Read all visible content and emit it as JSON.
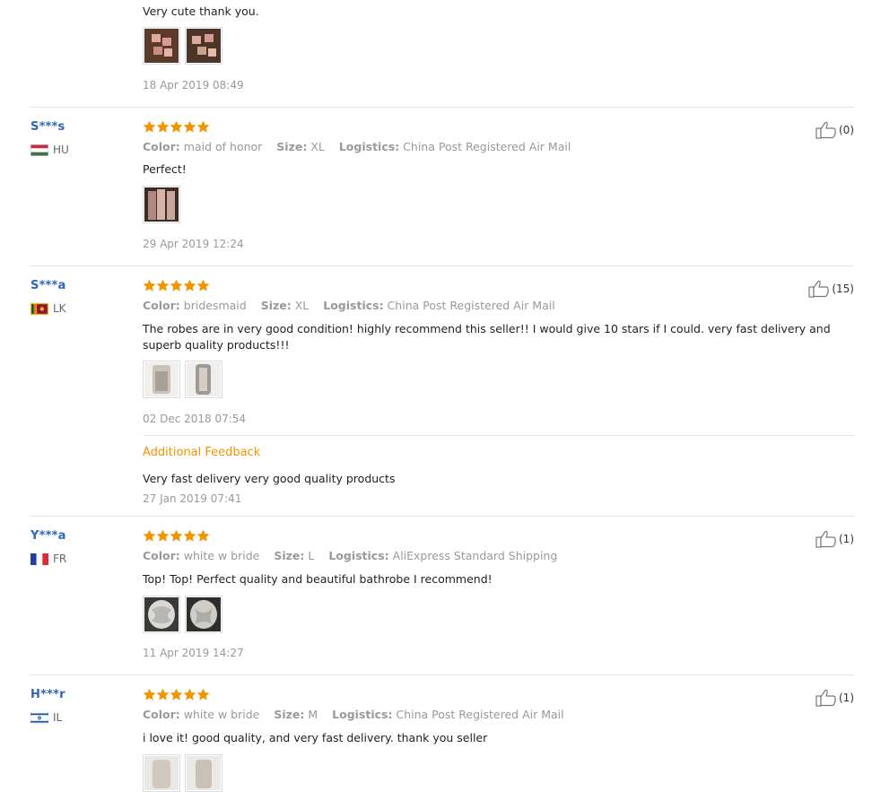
{
  "reviews": [
    {
      "text": "Very cute thank you.",
      "date": "18 Apr 2019 08:49"
    },
    {
      "user": "S***s",
      "country": "HU",
      "color_label": "Color:",
      "color": "maid of honor",
      "size_label": "Size:",
      "size": "XL",
      "logistics_label": "Logistics:",
      "logistics": "China Post Registered Air Mail",
      "text": "Perfect!",
      "date": "29 Apr 2019 12:24",
      "helpful": "(0)",
      "rating": 5
    },
    {
      "user": "S***a",
      "country": "LK",
      "color_label": "Color:",
      "color": "bridesmaid",
      "size_label": "Size:",
      "size": "XL",
      "logistics_label": "Logistics:",
      "logistics": "China Post Registered Air Mail",
      "text": "The robes are in very good condition! highly recommend this seller!! I would give 10 stars if I could. very fast delivery and superb quality products!!!",
      "date": "02 Dec 2018 07:54",
      "helpful": "(15)",
      "rating": 5,
      "additional_title": "Additional Feedback",
      "additional_text": "Very fast delivery very good quality products",
      "additional_date": "27 Jan 2019 07:41"
    },
    {
      "user": "Y***a",
      "country": "FR",
      "color_label": "Color:",
      "color": "white w bride",
      "size_label": "Size:",
      "size": "L",
      "logistics_label": "Logistics:",
      "logistics": "AliExpress Standard Shipping",
      "text": "Top! Top! Perfect quality and beautiful bathrobe I recommend!",
      "date": "11 Apr 2019 14:27",
      "helpful": "(1)",
      "rating": 5
    },
    {
      "user": "H***r",
      "country": "IL",
      "color_label": "Color:",
      "color": "white w bride",
      "size_label": "Size:",
      "size": "M",
      "logistics_label": "Logistics:",
      "logistics": "China Post Registered Air Mail",
      "text": "i love it! good quality, and very fast delivery. thank you seller",
      "helpful": "(1)",
      "rating": 5
    }
  ],
  "colors": {
    "star": "#f29400",
    "username": "#2f66b7",
    "additional_feedback": "#f29400",
    "meta": "#999999"
  },
  "icons": {
    "rating": "star-icon",
    "helpful": "thumbs-up-icon",
    "flags": [
      "hungary-flag-icon",
      "sri-lanka-flag-icon",
      "france-flag-icon",
      "israel-flag-icon"
    ]
  }
}
